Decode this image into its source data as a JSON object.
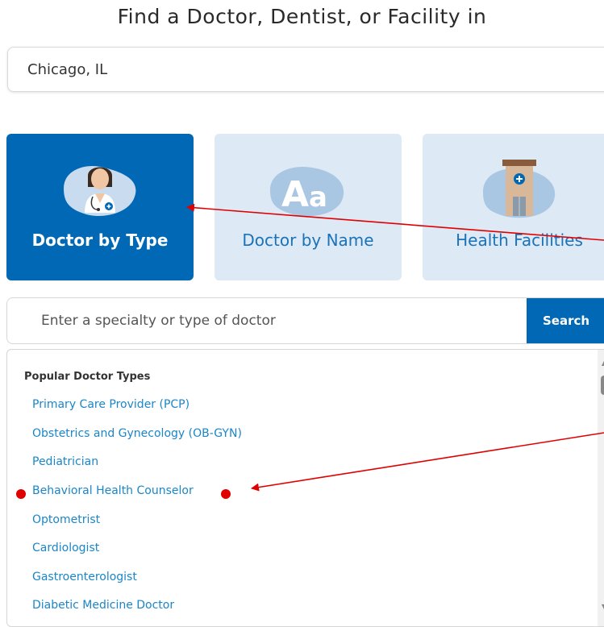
{
  "title": "Find a Doctor, Dentist, or Facility in",
  "location": {
    "value": "Chicago, IL"
  },
  "cards": [
    {
      "label": "Doctor by Type",
      "active": true
    },
    {
      "label": "Doctor by Name",
      "active": false
    },
    {
      "label": "Health Facilities",
      "active": false
    }
  ],
  "search": {
    "placeholder": "Enter a specialty or type of doctor",
    "button_label": "Search"
  },
  "popular": {
    "heading": "Popular Doctor Types",
    "items": [
      "Primary Care Provider (PCP)",
      "Obstetrics and Gynecology (OB-GYN)",
      "Pediatrician",
      "Behavioral Health Counselor",
      "Optometrist",
      "Cardiologist",
      "Gastroenterologist",
      "Diabetic Medicine Doctor"
    ]
  },
  "colors": {
    "brand_blue": "#0068b5",
    "card_light": "#dde9f5",
    "link_blue": "#1a86c8",
    "annotation_red": "#e00000"
  }
}
